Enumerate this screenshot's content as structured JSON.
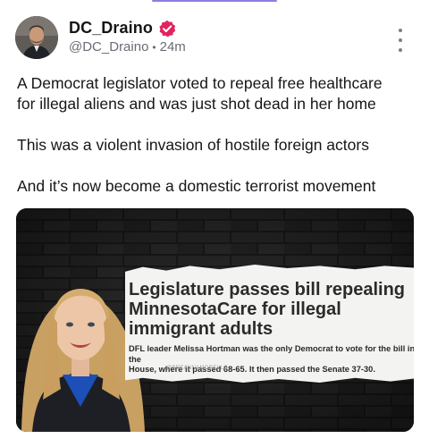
{
  "post": {
    "author": {
      "display_name": "DC_Draino",
      "handle": "@DC_Draino",
      "separator": "•",
      "time": "24m"
    },
    "paragraphs": [
      "A Democrat legislator voted to repeal free healthcare",
      "for illegal aliens and was just shot dead in her home",
      "This was a violent invasion of hostile foreign actors",
      "And it’s now become a domestic terrorist movement"
    ]
  },
  "media": {
    "headline_lines": [
      "Legislature passes bill repealing",
      "MinnesotaCare for illegal",
      "immigrant adults"
    ],
    "subtext_lines": [
      "DFL leader Melissa Hortman was the only Democrat to vote for the bill in the",
      "House, where it passed 68-65. It then passed the Senate 37-30."
    ],
    "credit": "@BREANNAMORELLO"
  },
  "colors": {
    "verified_badge": "#e0245e",
    "accent_bar": "#8b7fe0"
  },
  "icons": {
    "verified": "verified-badge-icon",
    "more": "more-vertical-icon"
  }
}
